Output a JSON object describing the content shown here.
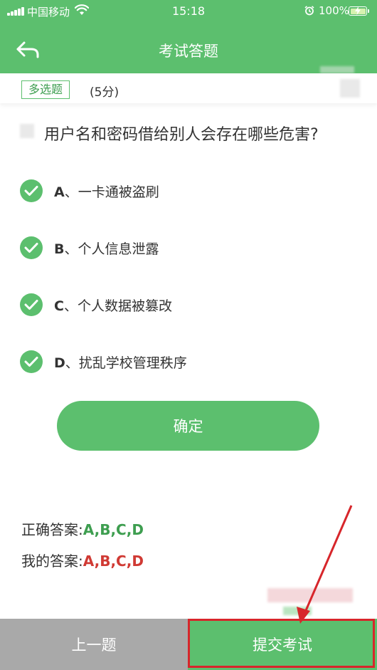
{
  "status_bar": {
    "carrier": "中国移动",
    "time": "15:18",
    "battery": "100%"
  },
  "nav": {
    "title": "考试答题",
    "back_icon": "back-arrow-icon"
  },
  "question": {
    "type_tag": "多选题",
    "score": "(5分)",
    "text": "用户名和密码借给别人会存在哪些危害?",
    "options": [
      {
        "letter": "A",
        "text": "、一卡通被盗刷",
        "checked": true
      },
      {
        "letter": "B",
        "text": "、个人信息泄露",
        "checked": true
      },
      {
        "letter": "C",
        "text": "、个人数据被篡改",
        "checked": true
      },
      {
        "letter": "D",
        "text": "、扰乱学校管理秩序",
        "checked": true
      }
    ],
    "confirm_label": "确定"
  },
  "answers": {
    "correct_label": "正确答案:",
    "correct_value": "A,B,C,D",
    "mine_label": "我的答案:",
    "mine_value": "A,B,C,D"
  },
  "footer": {
    "prev_label": "上一题",
    "submit_label": "提交考试"
  },
  "colors": {
    "primary_green": "#5cbf6e",
    "correct_green": "#3e9e50",
    "mine_red": "#d03a34",
    "disabled_gray": "#a9a9a9",
    "annotation_red": "#d7262b"
  }
}
